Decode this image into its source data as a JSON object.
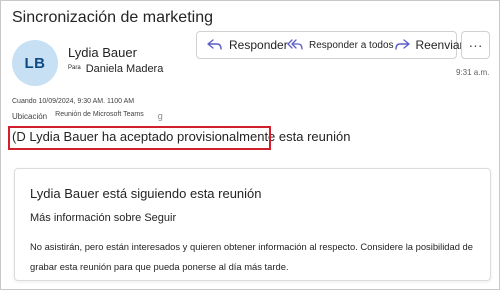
{
  "subject": "Sincronización de marketing",
  "sender": {
    "initials": "LB",
    "name": "Lydia Bauer",
    "to_label": "Para",
    "to_value": "Daniela Madera"
  },
  "toolbar": {
    "reply_label": "Responder",
    "reply_all_label": "Responder a todos",
    "forward_label": "Reenviar",
    "more_label": "···"
  },
  "time": "9:31 a.m.",
  "when_line": "Cuando 10/09/2024, 9:30 AM. 1100 AM",
  "location": {
    "label": "Ubicación",
    "value": "Reunión de Microsoft Teams",
    "extra": "g"
  },
  "status": {
    "text": "(D Lydia Bauer ha aceptado provisionalmente esta reunión"
  },
  "follow_card": {
    "title": "Lydia Bauer está siguiendo esta reunión",
    "more_info": "Más información sobre Seguir",
    "description": "No asistirán, pero están interesados y quieren obtener información al respecto. Considere la posibilidad de grabar esta reunión para que pueda ponerse al día más tarde."
  },
  "colors": {
    "accent": "#5b5fc7",
    "highlight_border": "#d1202c",
    "avatar_bg": "#c7e0f4",
    "avatar_text": "#0f4a85"
  },
  "icons": [
    "reply-icon",
    "reply-all-icon",
    "forward-icon",
    "more-icon"
  ]
}
